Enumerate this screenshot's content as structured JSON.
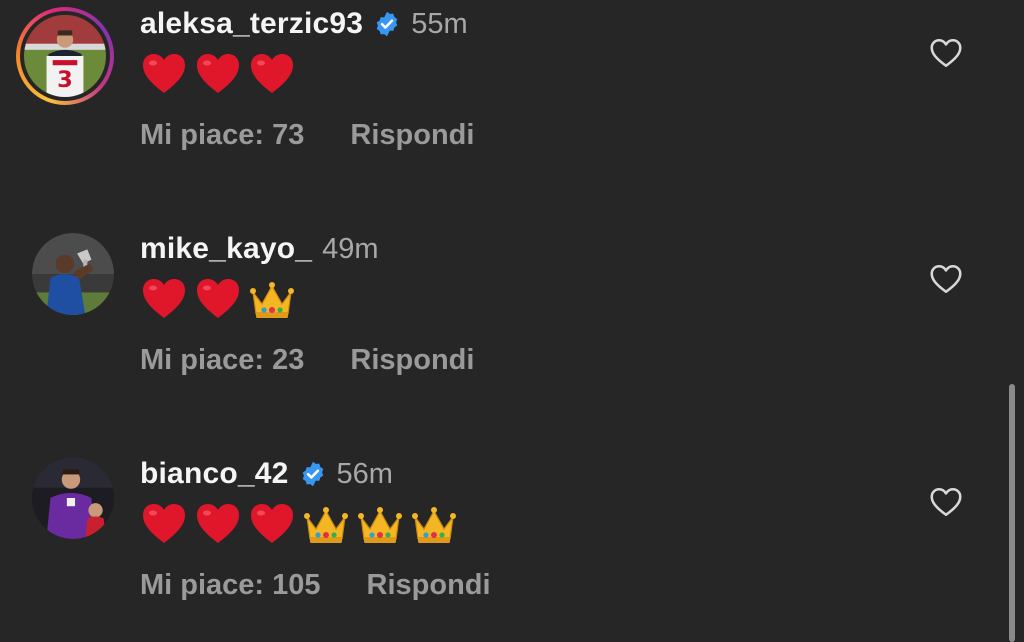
{
  "comments": [
    {
      "username": "aleksa_terzic93",
      "verified": true,
      "time": "55m",
      "emojis": [
        "heart",
        "heart",
        "heart"
      ],
      "likes_label": "Mi piace: 73",
      "reply_label": "Rispondi",
      "has_story_ring": true
    },
    {
      "username": "mike_kayo_",
      "verified": false,
      "time": "49m",
      "emojis": [
        "heart",
        "heart",
        "crown"
      ],
      "likes_label": "Mi piace: 23",
      "reply_label": "Rispondi",
      "has_story_ring": false
    },
    {
      "username": "bianco_42",
      "verified": true,
      "time": "56m",
      "emojis": [
        "heart",
        "heart",
        "heart",
        "crown",
        "crown",
        "crown"
      ],
      "likes_label": "Mi piace: 105",
      "reply_label": "Rispondi",
      "has_story_ring": false
    }
  ],
  "icons": {
    "verified": "verified-badge-icon",
    "like": "heart-outline-icon",
    "emoji_heart": "red-heart-emoji",
    "emoji_crown": "crown-emoji"
  },
  "colors": {
    "background": "#262627",
    "username": "#f5f5f5",
    "meta": "#a8a8a8",
    "verified": "#3897f0",
    "heart": "#e0162b"
  }
}
